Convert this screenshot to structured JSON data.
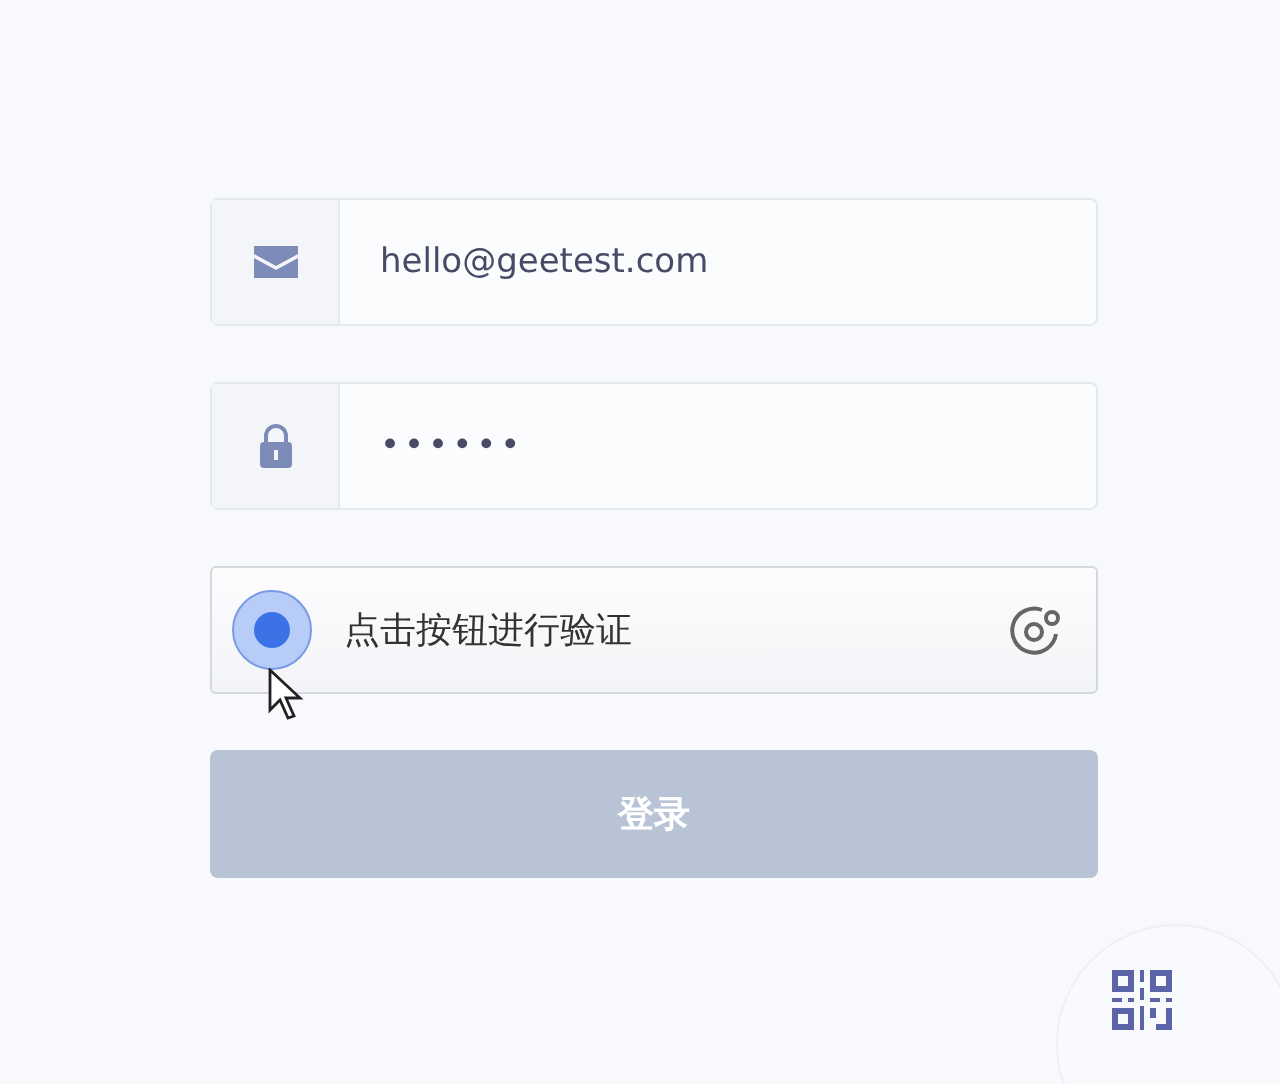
{
  "email": {
    "value": "hello@geetest.com"
  },
  "password": {
    "value": "••••••"
  },
  "captcha": {
    "label": "点击按钮进行验证"
  },
  "login_button": {
    "label": "登录",
    "disabled": true
  }
}
